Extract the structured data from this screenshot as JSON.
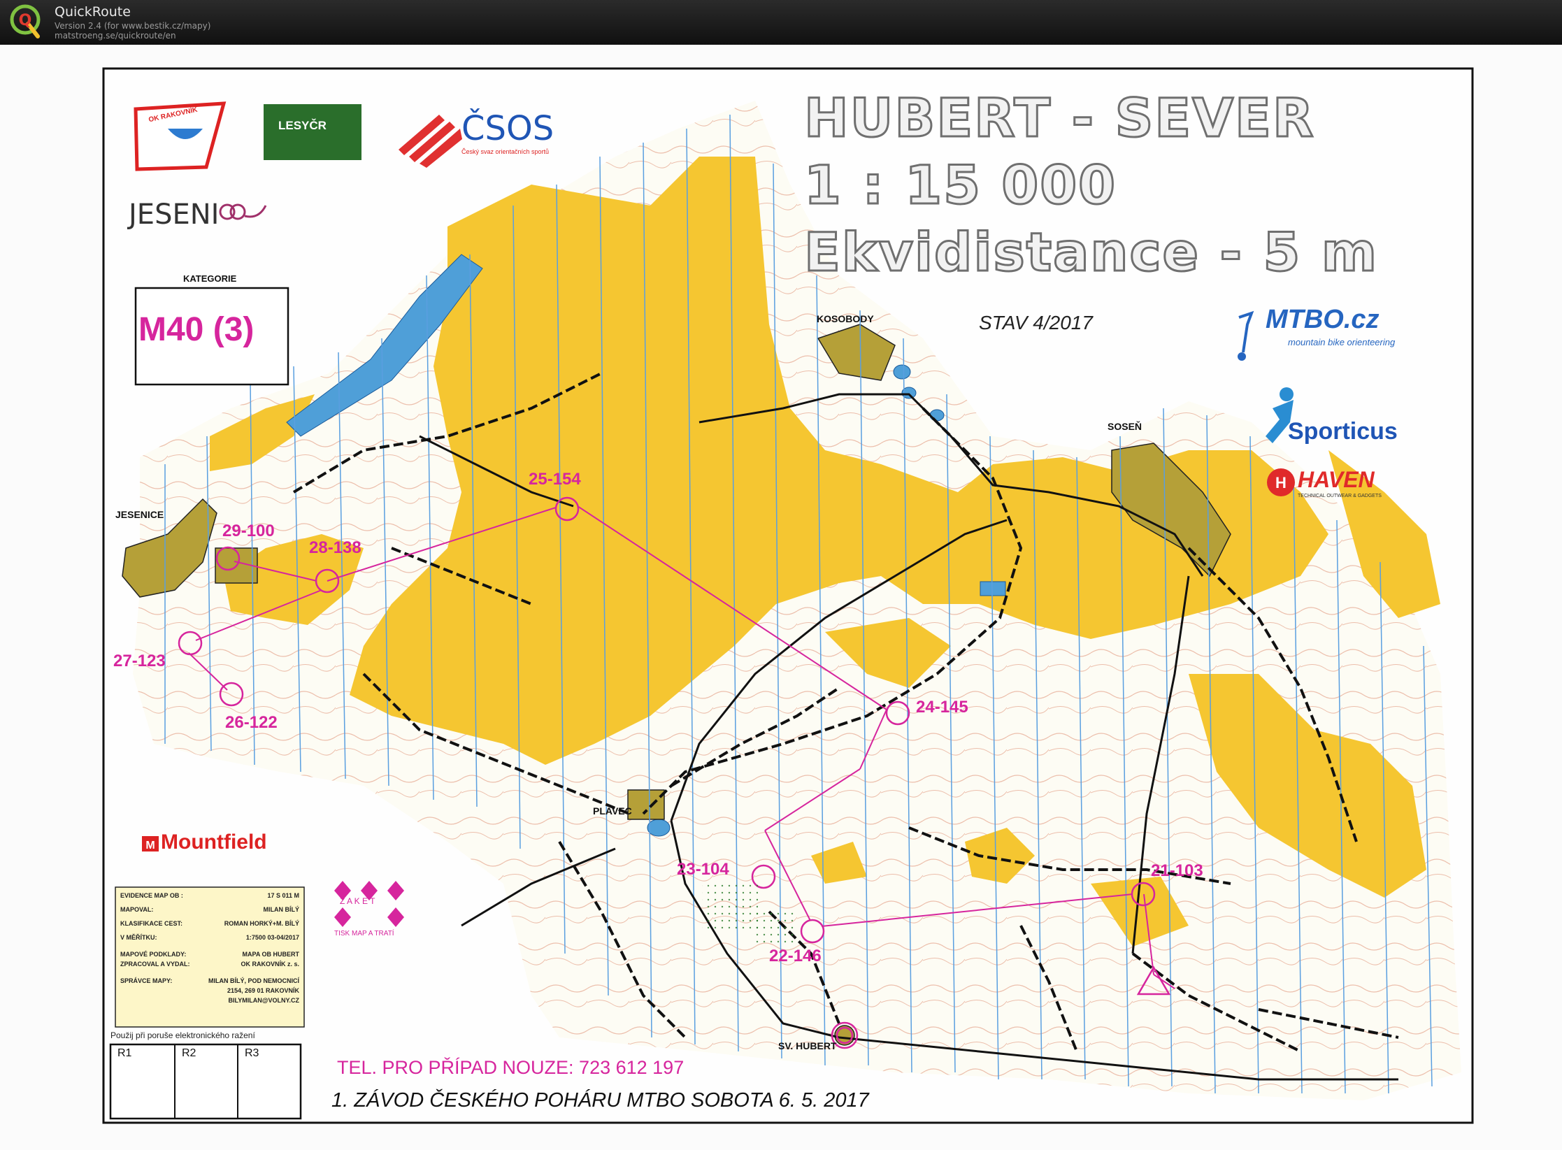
{
  "app": {
    "title": "QuickRoute",
    "version": "Version 2.4  (for www.bestik.cz/mapy)",
    "url": "matstroeng.se/quickroute/en",
    "logo_letter": "Q"
  },
  "map": {
    "title_line1": "HUBERT - SEVER",
    "title_line2": "1 : 15 000",
    "title_line3": "Ekvidistance - 5 m",
    "status": "STAV 4/2017",
    "category_label": "KATEGORIE",
    "category_value": "M40 (3)",
    "emergency_phone": "TEL. PRO PŘÍPAD NOUZE: 723 612 197",
    "event": "1. ZÁVOD ČESKÉHO POHÁRU MTBO SOBOTA 6. 5. 2017",
    "punch_note": "Použij při poruše elektronického ražení",
    "punch_boxes": [
      "R1",
      "R2",
      "R3"
    ],
    "sponsors": {
      "ok_rakovnik": "OK RAKOVNÍK",
      "lesy_cr": "LESYČR",
      "csos": "ČSOS",
      "csos_sub": "Český svaz orientačních sportů",
      "jesenice": "JESENI",
      "mtbo": "MTBO.cz",
      "mtbo_sub": "mountain bike orienteering",
      "sporticus": "Sporticus",
      "haven": "HAVEN",
      "haven_sub": "TECHNICAL OUTWEAR & GADGETS",
      "mountfield": "Mountfield",
      "zaket": "TISK MAP A TRATÍ",
      "zaket_letters": "Z A K E T"
    },
    "place_names": {
      "jesenice": "JESENICE",
      "kosobody": "KOSOBODY",
      "sosen": "SOSEŇ",
      "plavec": "PLAVEC",
      "sv_hubert": "SV. HUBERT"
    },
    "info_table": [
      {
        "label": "EVIDENCE MAP OB :",
        "value": "17 S 011 M"
      },
      {
        "label": "MAPOVAL:",
        "value": "MILAN BÍLÝ"
      },
      {
        "label": "KLASIFIKACE CEST:",
        "value": "ROMAN HORKÝ+M. BÍLÝ"
      },
      {
        "label": "V MĚŘÍTKU:",
        "value": "1:7500  03-04/2017"
      },
      {
        "label": "MAPOVÉ PODKLADY:",
        "value": "MAPA OB HUBERT"
      },
      {
        "label": "ZPRACOVAL A VYDAL:",
        "value": "OK RAKOVNÍK z. s."
      },
      {
        "label": "SPRÁVCE MAPY:",
        "value": "MILAN BÍLÝ, POD NEMOCNICÍ"
      },
      {
        "label": "",
        "value": "2154, 269 01 RAKOVNÍK"
      },
      {
        "label": "",
        "value": "BILYMILAN@VOLNY.CZ"
      }
    ],
    "controls": [
      "21-103",
      "22-146",
      "23-104",
      "24-145",
      "25-154",
      "26-122",
      "27-123",
      "28-138",
      "29-100"
    ],
    "colors": {
      "open_land": "#f5c631",
      "forest": "#fdfdf5",
      "course": "#d6259d",
      "water": "#4f9fd8",
      "settlement": "#b5a038",
      "magnetic_lines": "#5a9fe0"
    }
  }
}
